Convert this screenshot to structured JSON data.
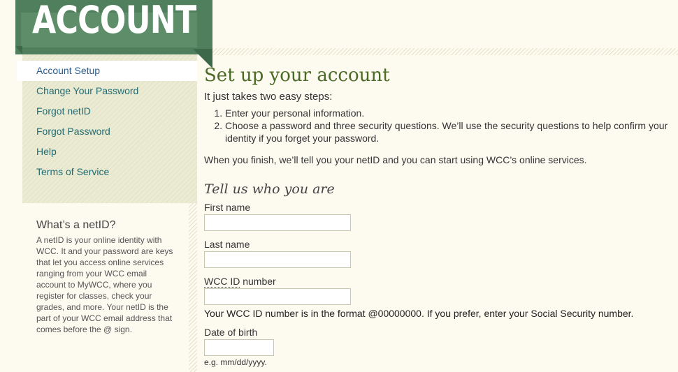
{
  "header": {
    "title": "ACCOUNT"
  },
  "sidebar": {
    "items": [
      {
        "label": "Account Setup"
      },
      {
        "label": "Change Your Password"
      },
      {
        "label": "Forgot netID"
      },
      {
        "label": "Forgot Password"
      },
      {
        "label": "Help"
      },
      {
        "label": "Terms of Service"
      }
    ],
    "active_index": 0,
    "info": {
      "title": "What’s a netID?",
      "body": "A netID is your online identity with WCC. It and your password are keys that let you access online services ranging from your WCC email account to MyWCC, where you register for classes, check your grades, and more. Your netID is the part of your WCC email address that comes before the @ sign."
    }
  },
  "main": {
    "title": "Set up your account",
    "intro": "It just takes two easy steps:",
    "steps": [
      "Enter your personal information.",
      "Choose a password and three security questions. We’ll use the security questions to help confirm your identity if you forget your password."
    ],
    "finish": "When you finish, we’ll tell you your netID and you can start using WCC’s online services.",
    "section_title": "Tell us who you are",
    "fields": {
      "first_name": {
        "label": "First name",
        "value": ""
      },
      "last_name": {
        "label": "Last name",
        "value": ""
      },
      "wcc_id": {
        "label_abbr": "WCC ID",
        "label_rest": " number",
        "value": "",
        "help": "Your WCC ID number is in the format @00000000. If you prefer, enter your Social Security number."
      },
      "dob": {
        "label": "Date of birth",
        "value": "",
        "hint": "e.g. mm/dd/yyyy."
      }
    }
  },
  "colors": {
    "banner": "#4f7f5c",
    "nav_link": "#1f6b72",
    "title_green": "#4a6a25",
    "background": "#fdfaf0"
  }
}
